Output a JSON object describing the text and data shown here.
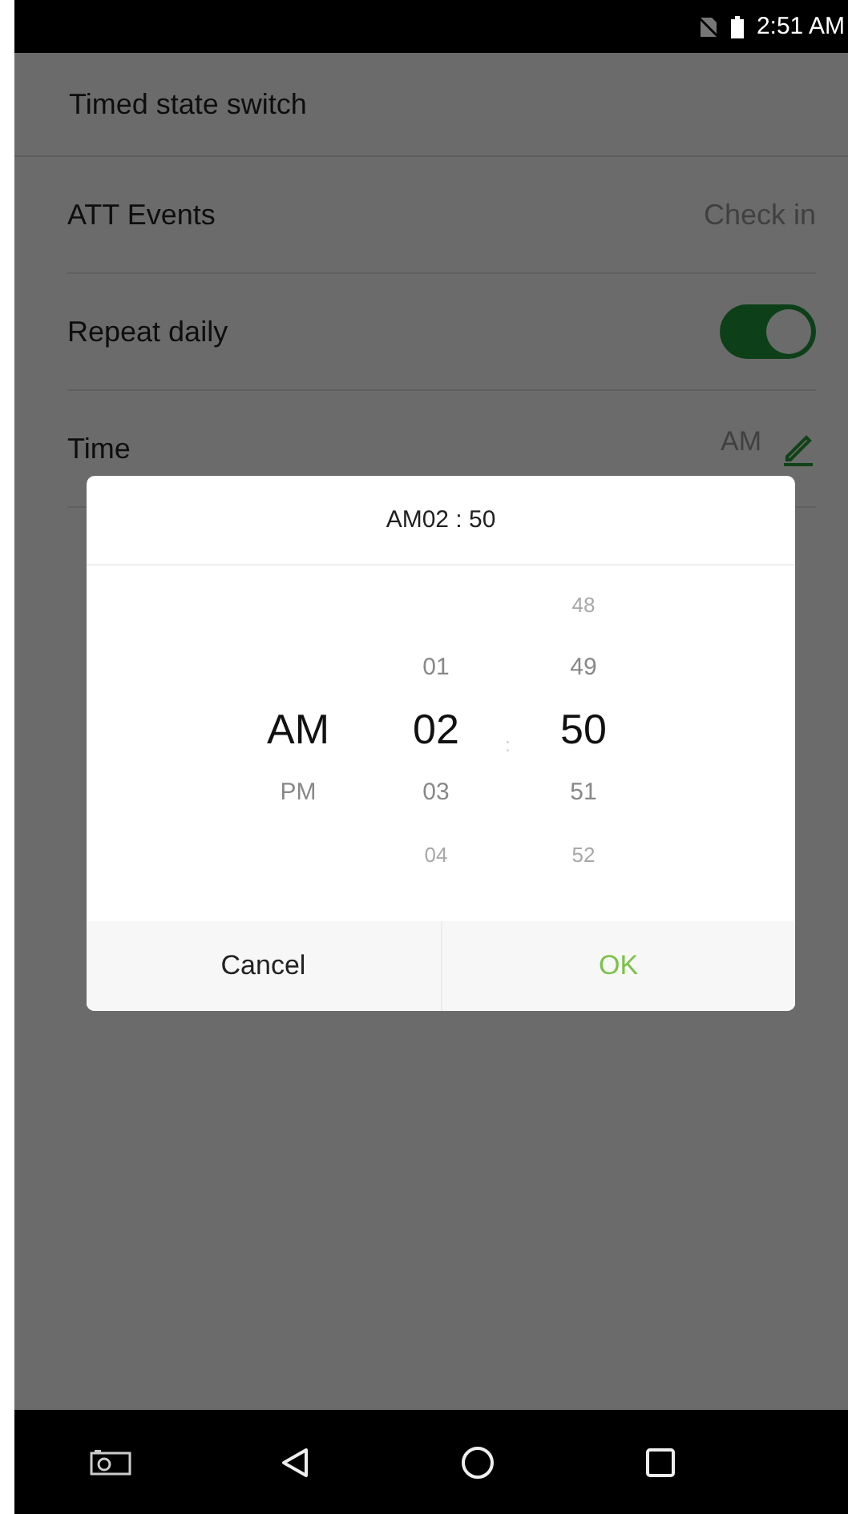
{
  "status_bar": {
    "time": "2:51 AM"
  },
  "settings": [
    {
      "kind": "header",
      "label": "Timed state switch"
    },
    {
      "kind": "value",
      "label": "ATT Events",
      "value": "Check in"
    },
    {
      "kind": "toggle",
      "label": "Repeat daily",
      "on": true
    },
    {
      "kind": "edit",
      "label": "Time",
      "value_lines": [
        "AM"
      ]
    }
  ],
  "dialog": {
    "title": "AM02 : 50",
    "separator": ":",
    "columns": [
      {
        "items": [
          {
            "text": "AM",
            "selected": true
          },
          {
            "text": "PM",
            "selected": false
          }
        ]
      },
      {
        "items": [
          {
            "text": "01",
            "selected": false
          },
          {
            "text": "02",
            "selected": true
          },
          {
            "text": "03",
            "selected": false
          },
          {
            "text": "04",
            "selected": false
          }
        ]
      },
      {
        "items": [
          {
            "text": "48",
            "selected": false
          },
          {
            "text": "49",
            "selected": false
          },
          {
            "text": "50",
            "selected": true
          },
          {
            "text": "51",
            "selected": false
          },
          {
            "text": "52",
            "selected": false
          }
        ]
      }
    ],
    "buttons": [
      {
        "label": "Cancel",
        "kind": "cancel"
      },
      {
        "label": "OK",
        "kind": "confirm"
      }
    ]
  }
}
